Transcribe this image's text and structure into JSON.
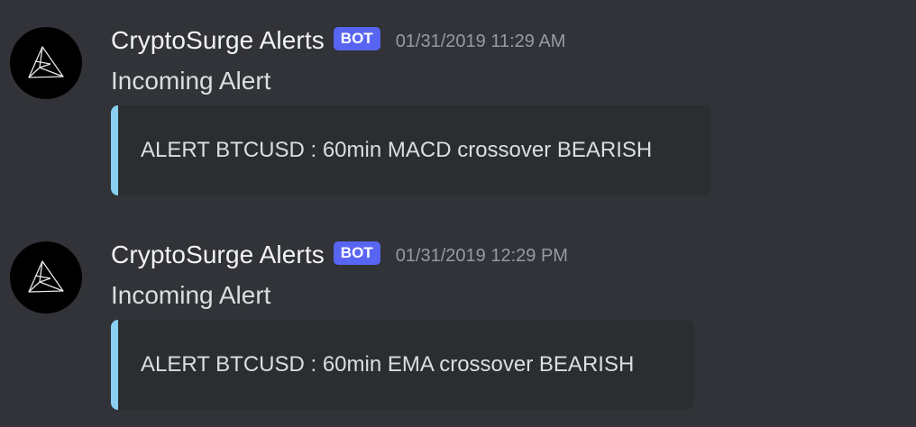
{
  "colors": {
    "background": "#313338",
    "embed_background": "#2b2d31",
    "embed_accent": "#89cff0",
    "bot_badge": "#5865f2",
    "username": "#f2f3f5",
    "timestamp": "#949ba4",
    "text": "#dbdee1"
  },
  "messages": [
    {
      "avatar_icon": "triangle-logo-icon",
      "author": "CryptoSurge Alerts",
      "badge": "BOT",
      "timestamp": "01/31/2019 11:29 AM",
      "content": "Incoming Alert",
      "embed_text": "ALERT BTCUSD : 60min MACD crossover BEARISH"
    },
    {
      "avatar_icon": "triangle-logo-icon",
      "author": "CryptoSurge Alerts",
      "badge": "BOT",
      "timestamp": "01/31/2019 12:29 PM",
      "content": "Incoming Alert",
      "embed_text": "ALERT BTCUSD : 60min EMA crossover BEARISH"
    }
  ]
}
